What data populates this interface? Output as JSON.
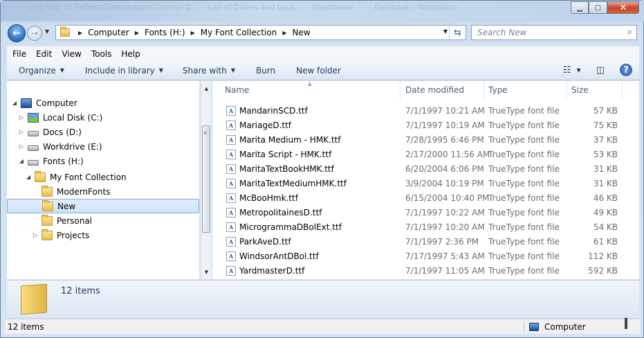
{
  "window": {
    "ghost_titles": [
      "Log: Log 31 Refresh",
      "Sweethearts License Q...",
      "List of Drives and Loca...",
      "Handbrake",
      "Facebook - Workplace"
    ]
  },
  "address": {
    "crumbs": [
      "Computer",
      "Fonts (H:)",
      "My Font Collection",
      "New"
    ]
  },
  "search": {
    "placeholder": "Search New"
  },
  "menu": {
    "file": "File",
    "edit": "Edit",
    "view": "View",
    "tools": "Tools",
    "help": "Help"
  },
  "commands": {
    "organize": "Organize",
    "include": "Include in library",
    "share": "Share with",
    "burn": "Burn",
    "new_folder": "New folder"
  },
  "tree": {
    "computer": "Computer",
    "local_disk": "Local Disk (C:)",
    "docs": "Docs (D:)",
    "workdrive": "Workdrive (E:)",
    "fonts": "Fonts (H:)",
    "collection": "My Font Collection",
    "modern": "ModernFonts",
    "new": "New",
    "personal": "Personal",
    "projects": "Projects"
  },
  "columns": {
    "name": "Name",
    "date": "Date modified",
    "type": "Type",
    "size": "Size"
  },
  "files": [
    {
      "name": "MandarinSCD.ttf",
      "date": "7/1/1997 10:21 AM",
      "type": "TrueType font file",
      "size": "57 KB"
    },
    {
      "name": "MariageD.ttf",
      "date": "7/1/1997 10:19 AM",
      "type": "TrueType font file",
      "size": "75 KB"
    },
    {
      "name": "Marita Medium - HMK.ttf",
      "date": "7/28/1995 6:46 PM",
      "type": "TrueType font file",
      "size": "37 KB"
    },
    {
      "name": "Marita Script - HMK.ttf",
      "date": "2/17/2000 11:56 AM",
      "type": "TrueType font file",
      "size": "53 KB"
    },
    {
      "name": "MaritaTextBookHMK.ttf",
      "date": "6/20/2004 6:06 PM",
      "type": "TrueType font file",
      "size": "31 KB"
    },
    {
      "name": "MaritaTextMediumHMK.ttf",
      "date": "3/9/2004 10:19 PM",
      "type": "TrueType font file",
      "size": "31 KB"
    },
    {
      "name": "McBooHmk.ttf",
      "date": "6/15/2004 10:40 PM",
      "type": "TrueType font file",
      "size": "46 KB"
    },
    {
      "name": "MetropolitainesD.ttf",
      "date": "7/1/1997 10:22 AM",
      "type": "TrueType font file",
      "size": "49 KB"
    },
    {
      "name": "MicrogrammaDBolExt.ttf",
      "date": "7/1/1997 10:20 AM",
      "type": "TrueType font file",
      "size": "54 KB"
    },
    {
      "name": "ParkAveD.ttf",
      "date": "7/1/1997 2:36 PM",
      "type": "TrueType font file",
      "size": "61 KB"
    },
    {
      "name": "WindsorAntDBol.ttf",
      "date": "7/17/1997 5:43 AM",
      "type": "TrueType font file",
      "size": "112 KB"
    },
    {
      "name": "YardmasterD.ttf",
      "date": "7/1/1997 11:05 AM",
      "type": "TrueType font file",
      "size": "592 KB"
    }
  ],
  "details": {
    "count": "12 items"
  },
  "status": {
    "left": "12 items",
    "right": "Computer"
  }
}
